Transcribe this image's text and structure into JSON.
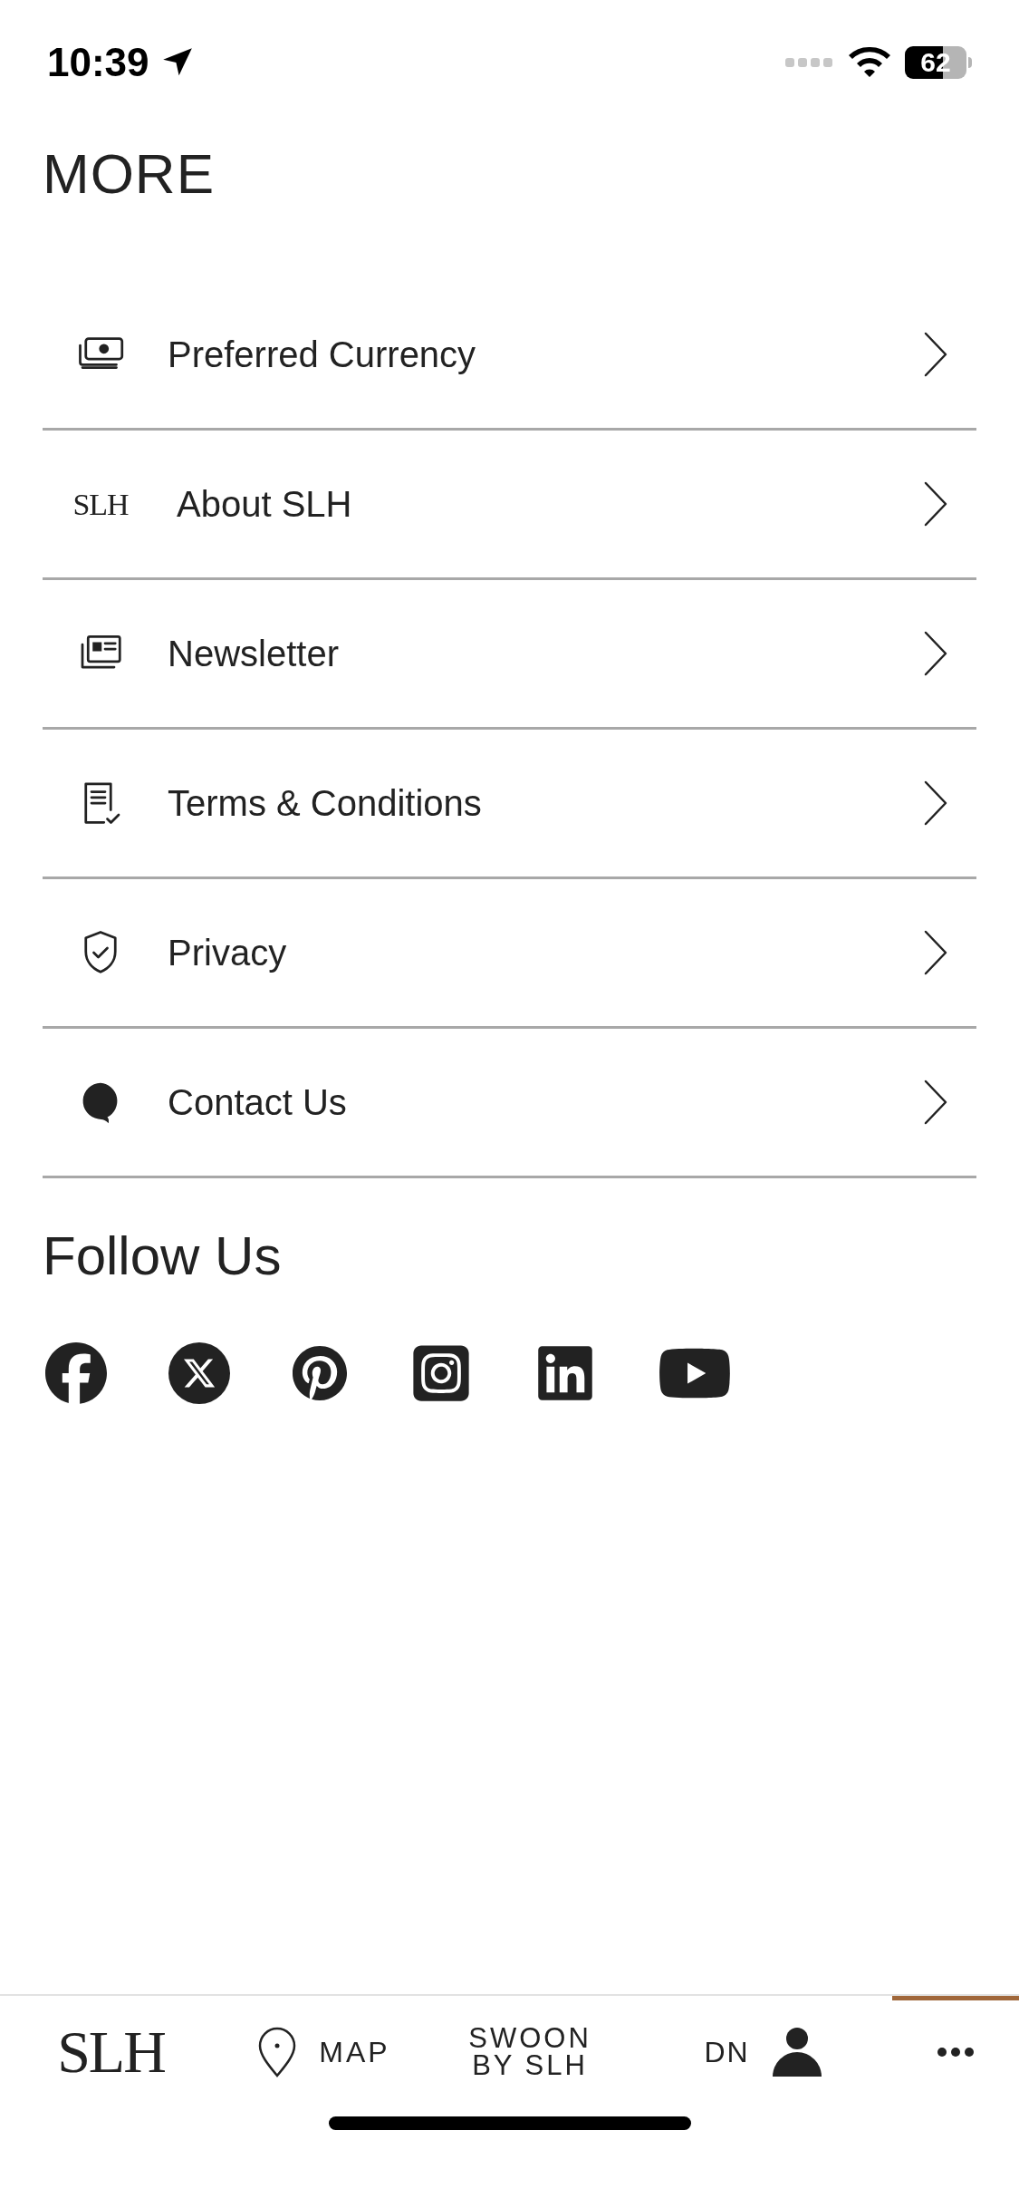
{
  "status_bar": {
    "time": "10:39",
    "battery": "62"
  },
  "title": "MORE",
  "menu": [
    {
      "kind": "icon",
      "label": "Preferred Currency"
    },
    {
      "kind": "logo",
      "logo": "SLH",
      "label": "About SLH"
    },
    {
      "kind": "icon",
      "label": "Newsletter"
    },
    {
      "kind": "icon",
      "label": "Terms & Conditions"
    },
    {
      "kind": "icon",
      "label": "Privacy"
    },
    {
      "kind": "icon",
      "label": "Contact Us"
    }
  ],
  "follow": {
    "title": "Follow Us"
  },
  "tab_bar": [
    {
      "kind": "logo",
      "label": "SLH",
      "selected": false
    },
    {
      "kind": "map",
      "label": "MAP",
      "selected": false
    },
    {
      "kind": "text",
      "label": "SWOON BY SLH",
      "selected": false
    },
    {
      "kind": "profile",
      "label": "DN",
      "selected": false
    },
    {
      "kind": "more",
      "selected": true
    }
  ]
}
